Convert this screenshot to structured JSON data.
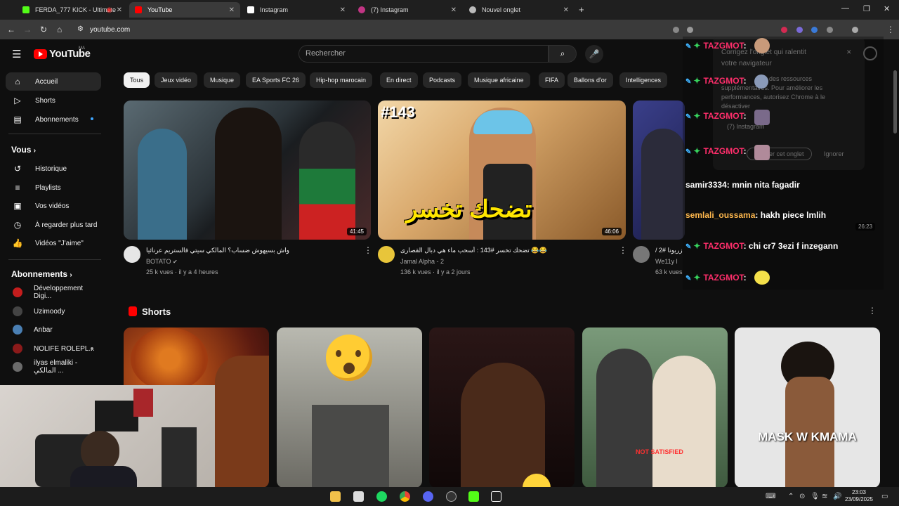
{
  "browser": {
    "tabs": [
      {
        "label": "FERDA_777 KICK - Ultimate",
        "active": false
      },
      {
        "label": "YouTube",
        "active": true
      },
      {
        "label": "Instagram",
        "active": false
      },
      {
        "label": "(7) Instagram",
        "active": false
      },
      {
        "label": "Nouvel onglet",
        "active": false
      }
    ],
    "new_tab": "+",
    "url": "youtube.com"
  },
  "header": {
    "logo": "YouTube",
    "logo_region": "MA",
    "search_placeholder": "Rechercher"
  },
  "sidebar": {
    "main": [
      {
        "label": "Accueil",
        "icon": "home-icon",
        "active": true
      },
      {
        "label": "Shorts",
        "icon": "shorts-icon",
        "active": false
      },
      {
        "label": "Abonnements",
        "icon": "subscriptions-icon",
        "active": false
      }
    ],
    "you_heading": "Vous",
    "you": [
      {
        "label": "Historique",
        "icon": "history-icon"
      },
      {
        "label": "Playlists",
        "icon": "playlists-icon"
      },
      {
        "label": "Vos vidéos",
        "icon": "your-videos-icon"
      },
      {
        "label": "À regarder plus tard",
        "icon": "watch-later-icon"
      },
      {
        "label": "Vidéos \"J'aime\"",
        "icon": "liked-icon"
      }
    ],
    "subs_heading": "Abonnements",
    "subs": [
      {
        "label": "Développement Digi...",
        "color": "#c41d1d"
      },
      {
        "label": "Uzimoody",
        "color": "#444444"
      },
      {
        "label": "Anbar",
        "color": "#4a7fb3"
      },
      {
        "label": "NOLIFE ROLEPL...",
        "color": "#8b1a1a"
      },
      {
        "label": "ilyas elmaliki - المالكي ...",
        "color": "#6b6b6b"
      }
    ]
  },
  "chips": [
    "Tous",
    "Jeux vidéo",
    "Musique",
    "EA Sports FC 26",
    "Hip-hop marocain",
    "En direct",
    "Podcasts",
    "Musique africaine",
    "FIFA",
    "Ballons d'or",
    "Intelligences"
  ],
  "videos": [
    {
      "title": "واش بسيهوش ضساب؟ المالكي سيتي فالستريم عرنائيا",
      "channel": "BOTATO",
      "meta": "25 k vues · il y a 4 heures",
      "duration": "41:45"
    },
    {
      "title": "تضحك تخسر #143 : أسحب ماء هي دبال القصارى 😂😂",
      "channel": "Jamal Alpha - 2",
      "meta": "136 k vues · il y a 2 jours",
      "duration": "46:06",
      "thumb_badge": "#143",
      "thumb_text": "تضحك تخسر"
    },
    {
      "title": "/ 2# زريونا",
      "channel": "We11y l",
      "meta": "63 k vues",
      "duration": "26:23"
    }
  ],
  "shorts": {
    "heading": "Shorts",
    "items": [
      {
        "overlay": ""
      },
      {
        "overlay": ""
      },
      {
        "overlay": ""
      },
      {
        "overlay": "NOT SATISFIED"
      },
      {
        "overlay": "MASK W KMAMA"
      }
    ]
  },
  "chat": [
    {
      "user": "TAZGMOT",
      "message": "",
      "user_color": "#ff2e6b"
    },
    {
      "user": "TAZGMOT",
      "message": "",
      "user_color": "#ff2e6b"
    },
    {
      "user": "TAZGMOT",
      "message": "",
      "user_color": "#ff2e6b"
    },
    {
      "user": "TAZGMOT",
      "message": "",
      "user_color": "#ff2e6b"
    },
    {
      "user": "samir3334",
      "message": "mnin nita fagadir",
      "user_color": "#ffffff"
    },
    {
      "user": "semlali_oussama",
      "message": "hakh piece lmlih",
      "user_color": "#ffb84d"
    },
    {
      "user": "TAZGMOT",
      "message": "chi cr7 3ezi f inzegann",
      "user_color": "#ff2e6b"
    },
    {
      "user": "TAZGMOT",
      "message": "",
      "user_color": "#ff2e6b"
    }
  ],
  "notification": {
    "line1": "Corrigez l'onglet qui ralentit",
    "line2": "votre navigateur",
    "line3": "des ressources",
    "line4": "supplémentaires. Pour améliorer les",
    "line5": "performances, autorisez Chrome à le",
    "line6": "désactiver",
    "tab_label": "(7) Instagram",
    "button1": "Fermer cet onglet",
    "button2": "Ignorer"
  },
  "taskbar": {
    "time": "23:03",
    "date": "23/09/2025"
  },
  "colors": {
    "youtube_red": "#ff0000",
    "chat_mod_name": "#ff2e6b",
    "chat_badge": "#3fb3ff",
    "chat_star": "#37d35d"
  }
}
